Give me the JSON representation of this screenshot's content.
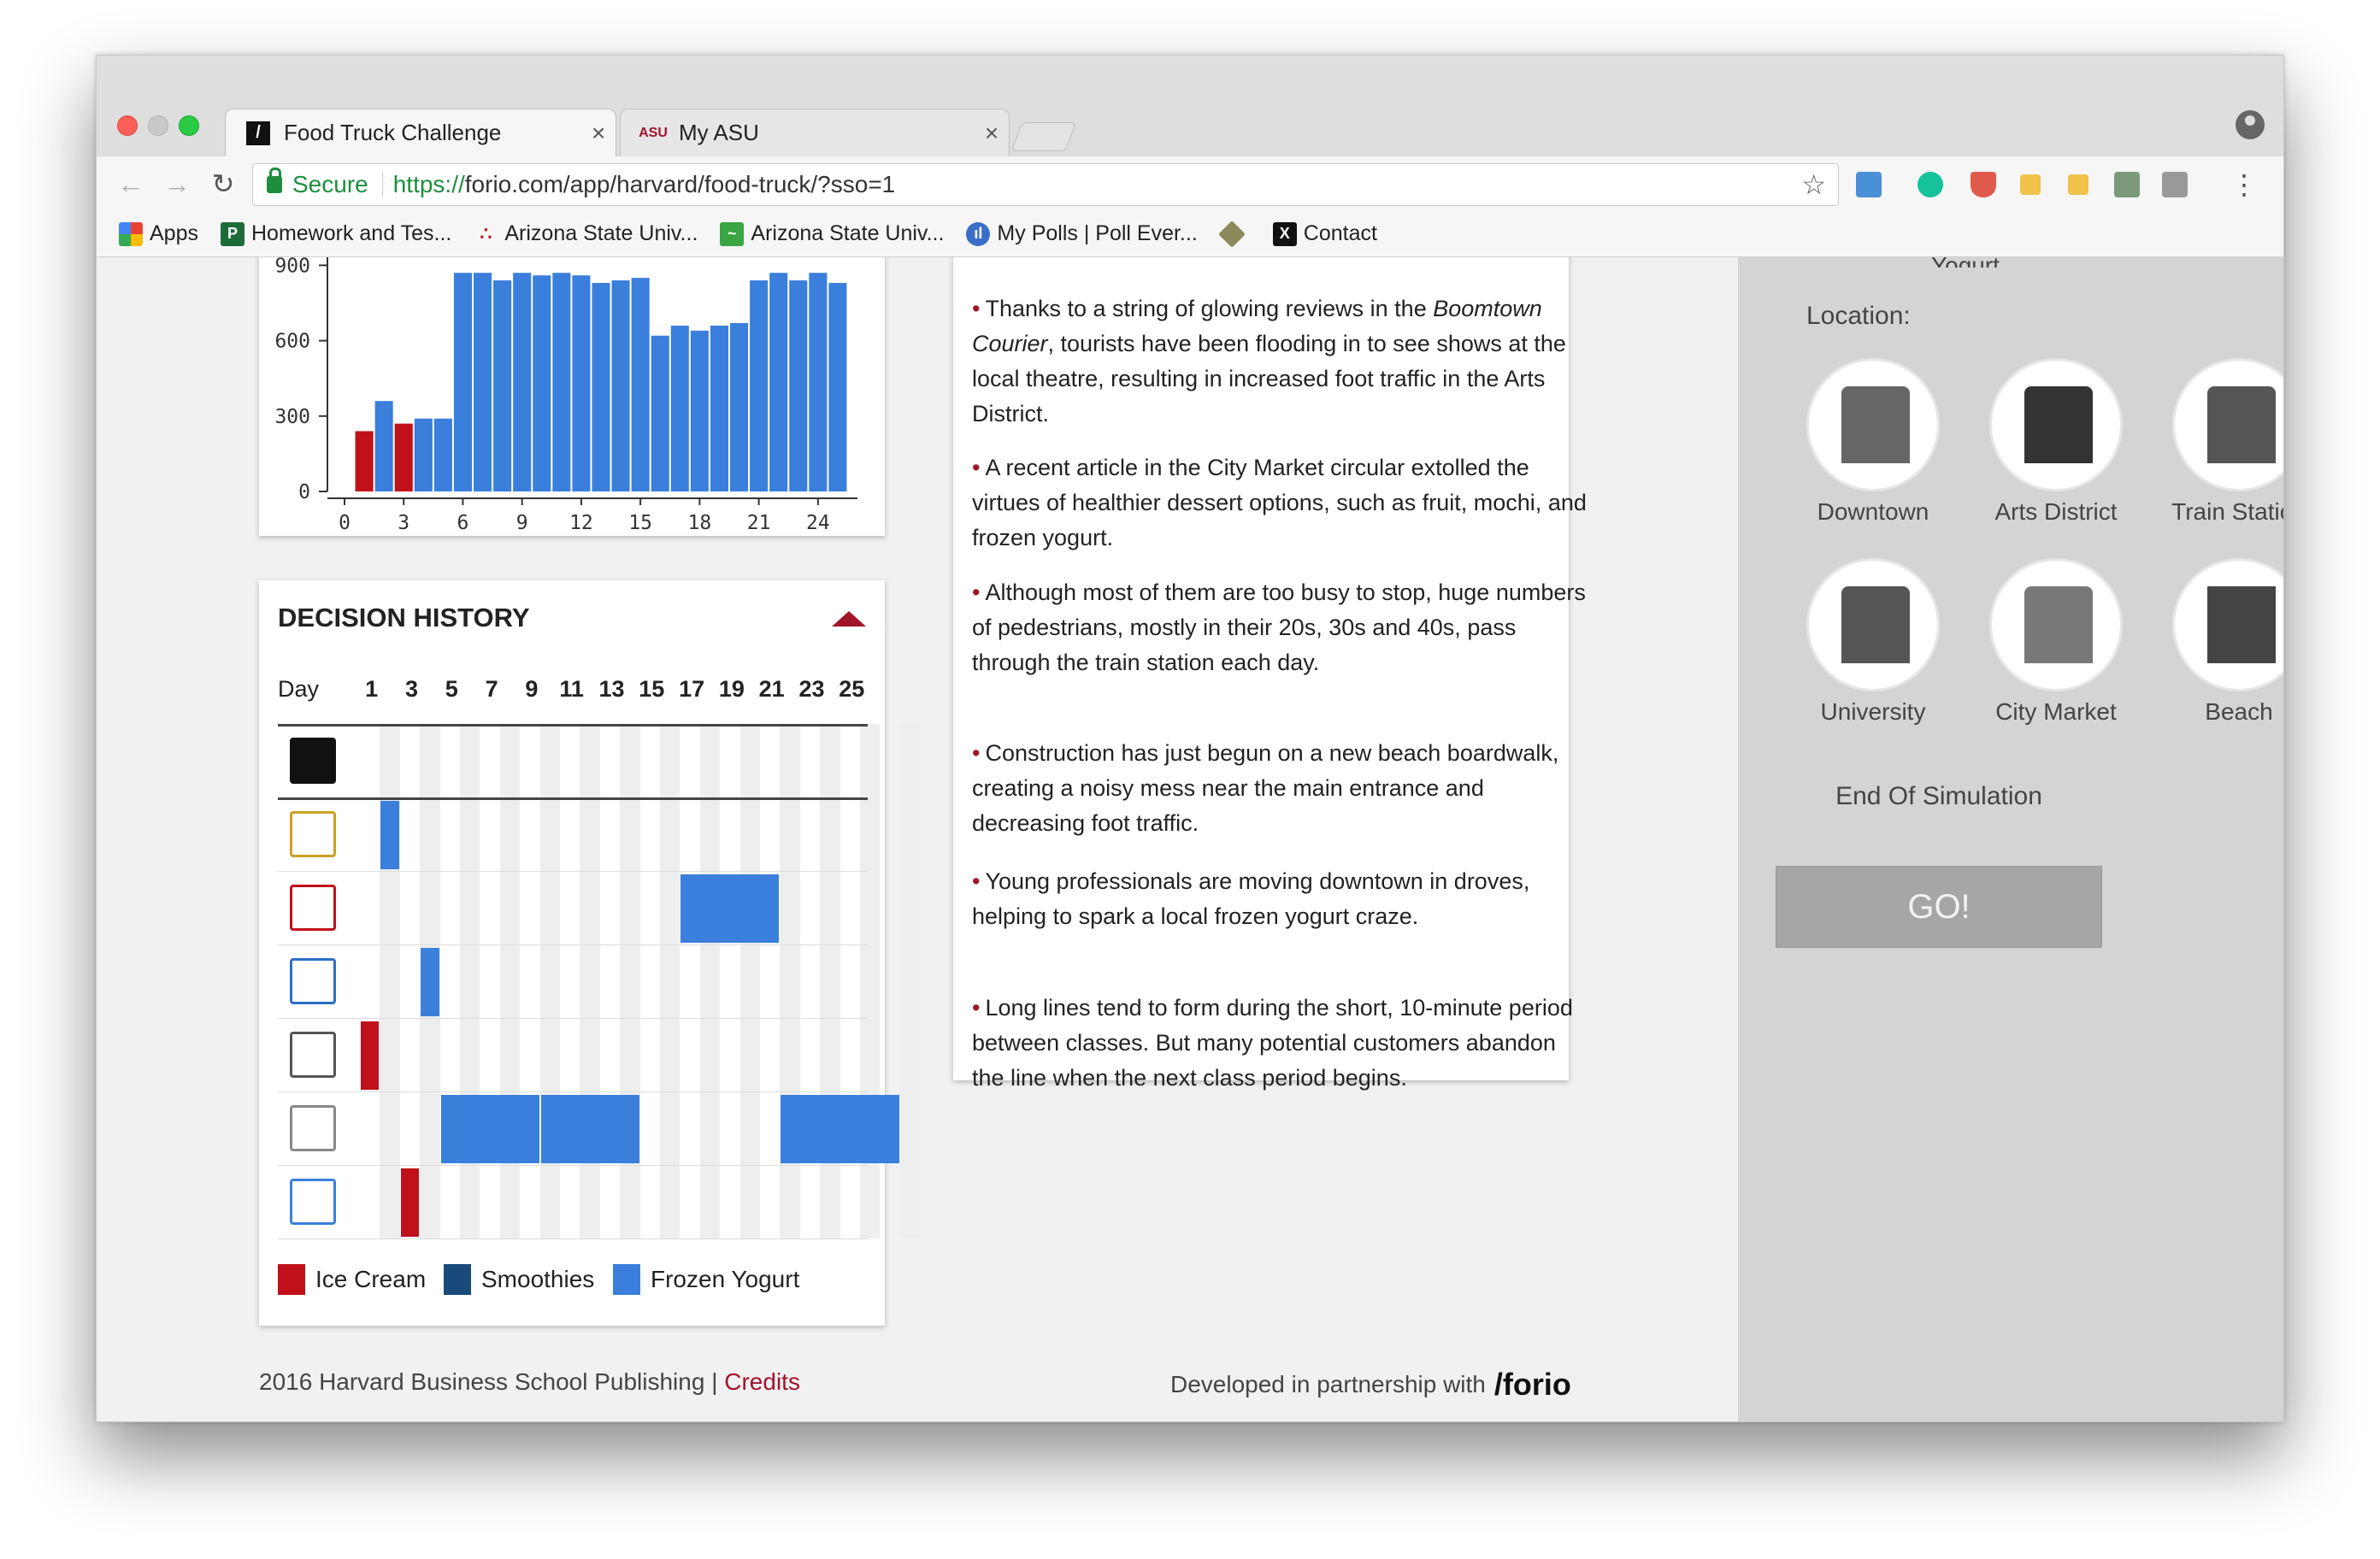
{
  "browser": {
    "tabs": [
      {
        "title": "Food Truck Challenge",
        "favicon": "forio-slash-icon"
      },
      {
        "title": "My ASU",
        "favicon": "asu-icon"
      }
    ],
    "secure_label": "Secure",
    "url_scheme": "https://",
    "url_rest": "forio.com/app/harvard/food-truck/?sso=1",
    "bookmarks": [
      {
        "label": "Apps",
        "icon": "apps-grid-icon"
      },
      {
        "label": "Homework and Tes...",
        "icon": "p-icon"
      },
      {
        "label": "Arizona State Univ...",
        "icon": "dots-icon"
      },
      {
        "label": "Arizona State Univ...",
        "icon": "green-chart-icon"
      },
      {
        "label": "My Polls | Poll Ever...",
        "icon": "poll-icon"
      },
      {
        "label": "",
        "icon": "diamond-icon"
      },
      {
        "label": "Contact",
        "icon": "x-icon"
      }
    ]
  },
  "sales_chart": {
    "chart_data": {
      "type": "bar",
      "x": [
        1,
        2,
        3,
        4,
        5,
        6,
        7,
        8,
        9,
        10,
        11,
        12,
        13,
        14,
        15,
        16,
        17,
        18,
        19,
        20,
        21,
        22,
        23,
        24,
        25
      ],
      "values": [
        240,
        360,
        270,
        290,
        290,
        870,
        870,
        840,
        870,
        860,
        870,
        860,
        830,
        840,
        850,
        620,
        660,
        640,
        660,
        670,
        840,
        870,
        840,
        870,
        830
      ],
      "colors": [
        "#c0101a",
        "#3b7fdc",
        "#c0101a",
        "#3b7fdc",
        "#3b7fdc",
        "#3b7fdc",
        "#3b7fdc",
        "#3b7fdc",
        "#3b7fdc",
        "#3b7fdc",
        "#3b7fdc",
        "#3b7fdc",
        "#3b7fdc",
        "#3b7fdc",
        "#3b7fdc",
        "#3b7fdc",
        "#3b7fdc",
        "#3b7fdc",
        "#3b7fdc",
        "#3b7fdc",
        "#3b7fdc",
        "#3b7fdc",
        "#3b7fdc",
        "#3b7fdc",
        "#3b7fdc"
      ],
      "y_ticks": [
        "0",
        "300",
        "600",
        "900"
      ],
      "x_ticks": [
        "0",
        "3",
        "6",
        "9",
        "12",
        "15",
        "18",
        "21",
        "24"
      ],
      "ylim": [
        0,
        1000
      ],
      "xlim": [
        0,
        26
      ]
    }
  },
  "decision_history": {
    "title": "DECISION HISTORY",
    "day_label": "Day",
    "days": [
      "1",
      "3",
      "5",
      "7",
      "9",
      "11",
      "13",
      "15",
      "17",
      "19",
      "21",
      "23",
      "25"
    ],
    "rows": [
      "data-icon",
      "downtown-icon",
      "arts-district-icon",
      "train-station-icon",
      "university-icon",
      "city-market-icon",
      "beach-icon"
    ],
    "legend": [
      {
        "label": "Ice Cream",
        "color": "#c0101a"
      },
      {
        "label": "Smoothies",
        "color": "#1a4a7a"
      },
      {
        "label": "Frozen Yogurt",
        "color": "#3b7fdc"
      }
    ]
  },
  "news": [
    {
      "before": "Thanks to a string of glowing reviews in the ",
      "em": "Boomtown Courier",
      "after": ", tourists have been flooding in to see shows at the local theatre, resulting in increased foot traffic in the Arts District."
    },
    {
      "before": "A recent article in the City Market circular extolled the virtues of healthier dessert options, such as fruit, mochi, and frozen yogurt.",
      "em": "",
      "after": ""
    },
    {
      "before": "Although most of them are too busy to stop, huge numbers of pedestrians, mostly in their 20s, 30s and 40s, pass through the train station each day.",
      "em": "",
      "after": ""
    },
    {
      "before": "Construction has just begun on a new beach boardwalk, creating a noisy mess near the main entrance and decreasing foot traffic.",
      "em": "",
      "after": ""
    },
    {
      "before": "Young professionals are moving downtown in droves, helping to spark a local frozen yogurt craze.",
      "em": "",
      "after": ""
    },
    {
      "before": "Long lines tend to form during the short, 10-minute period between classes. But many potential customers abandon the line when the next class period begins.",
      "em": "",
      "after": ""
    }
  ],
  "sidebar": {
    "partial_top_label": "Yogurt",
    "location_label": "Location:",
    "locations": [
      {
        "name": "Downtown",
        "icon": "downtown-icon"
      },
      {
        "name": "Arts District",
        "icon": "arts-district-icon"
      },
      {
        "name": "Train Station",
        "icon": "train-station-icon"
      },
      {
        "name": "University",
        "icon": "university-icon"
      },
      {
        "name": "City Market",
        "icon": "city-market-icon"
      },
      {
        "name": "Beach",
        "icon": "beach-icon"
      }
    ],
    "end_label": "End Of Simulation",
    "go_label": "GO!"
  },
  "footer": {
    "copyright": "2016 Harvard Business School Publishing | ",
    "credits": "Credits",
    "partnership": "Developed in partnership with",
    "logo": "/forio"
  },
  "colors": {
    "accent_red": "#a0142a",
    "ice_cream": "#c0101a",
    "frozen_yogurt": "#3b7fdc",
    "smoothies": "#1a4a7a",
    "sidebar_bg": "#d4d4d4"
  }
}
